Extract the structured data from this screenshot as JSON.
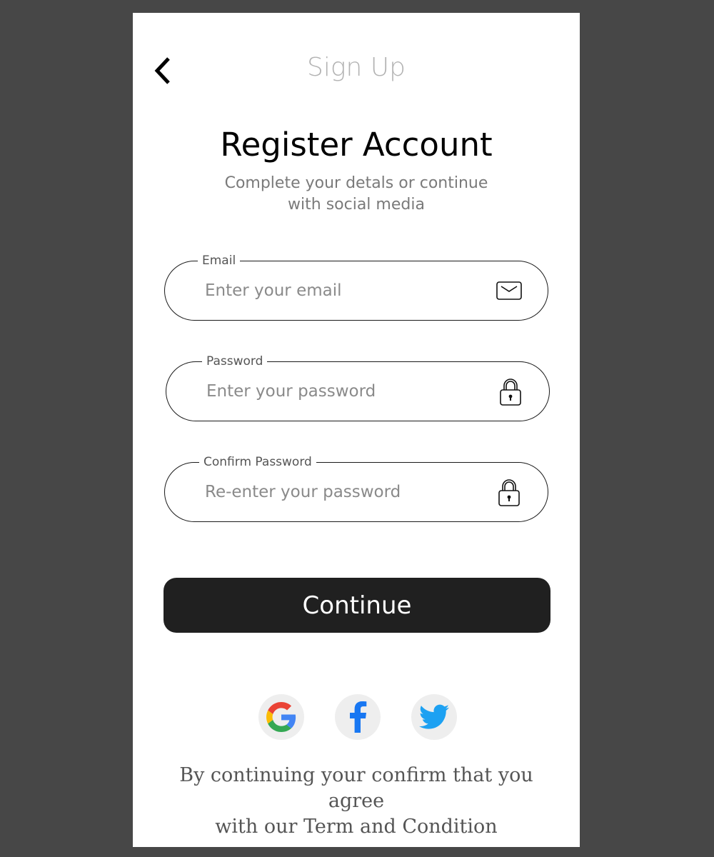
{
  "header": {
    "back_icon": "chevron-left-icon",
    "title": "Sign Up"
  },
  "intro": {
    "heading": "Register Account",
    "subheading": "Complete your detals or continue with social media"
  },
  "form": {
    "email": {
      "label": "Email",
      "placeholder": "Enter your email",
      "value": "",
      "icon": "envelope-icon"
    },
    "password": {
      "label": "Password",
      "placeholder": "Enter your password",
      "value": "",
      "icon": "lock-icon"
    },
    "confirm_password": {
      "label": "Confirm Password",
      "placeholder": "Re-enter your password",
      "value": "",
      "icon": "lock-icon"
    },
    "submit_label": "Continue"
  },
  "social": [
    {
      "name": "Google",
      "icon": "google-icon"
    },
    {
      "name": "Facebook",
      "icon": "facebook-icon"
    },
    {
      "name": "Twitter",
      "icon": "twitter-icon"
    }
  ],
  "footer": {
    "terms_line1": "By continuing your confirm that you agree",
    "terms_line2": "with our Term and Condition"
  },
  "colors": {
    "background": "#474747",
    "screen": "#ffffff",
    "button": "#202020",
    "title_gray": "#b3b3b3",
    "facebook": "#1877f2",
    "twitter": "#1da1f2"
  }
}
